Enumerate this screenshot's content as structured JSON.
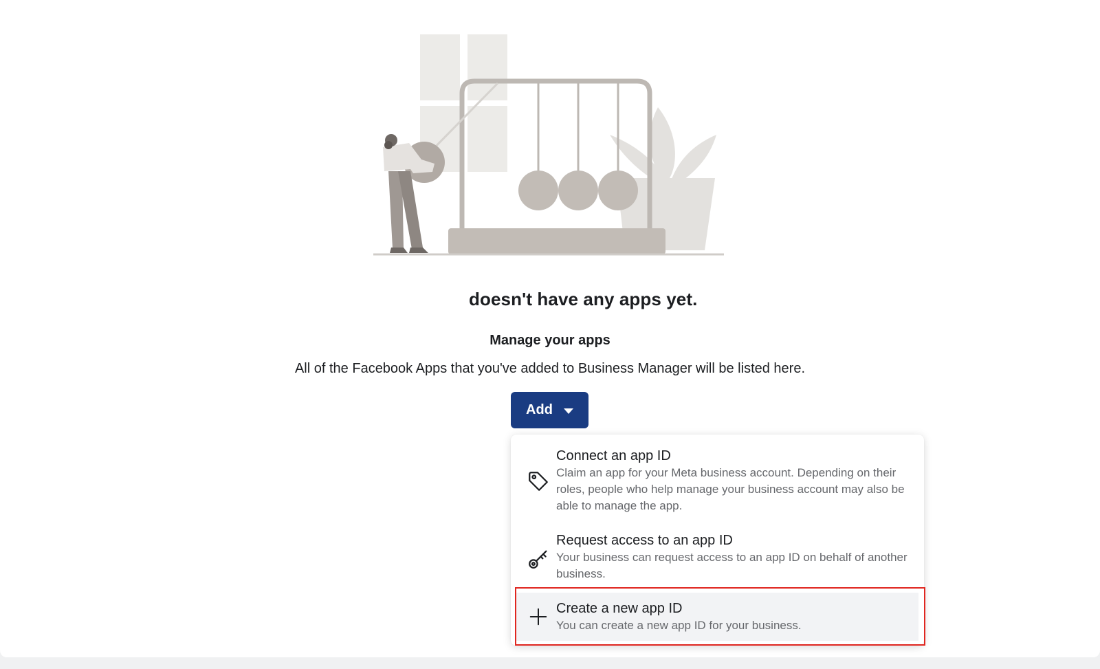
{
  "empty_state": {
    "headline": "doesn't have any apps yet.",
    "subtitle": "Manage your apps",
    "description": "All of the Facebook Apps that you've added to Business Manager will be listed here."
  },
  "add_button": {
    "label": "Add",
    "color": "#1a3c82"
  },
  "add_menu": {
    "items": [
      {
        "icon": "tag-icon",
        "title": "Connect an app ID",
        "description": "Claim an app for your Meta business account. Depending on their roles, people who help manage your business account may also be able to manage the app."
      },
      {
        "icon": "key-icon",
        "title": "Request access to an app ID",
        "description": "Your business can request access to an app ID on behalf of another business."
      },
      {
        "icon": "plus-icon",
        "title": "Create a new app ID",
        "description": "You can create a new app ID for your business.",
        "highlighted": true
      }
    ]
  },
  "colors": {
    "highlight_border": "#e0261f",
    "illustration": "#bdb8b3"
  }
}
